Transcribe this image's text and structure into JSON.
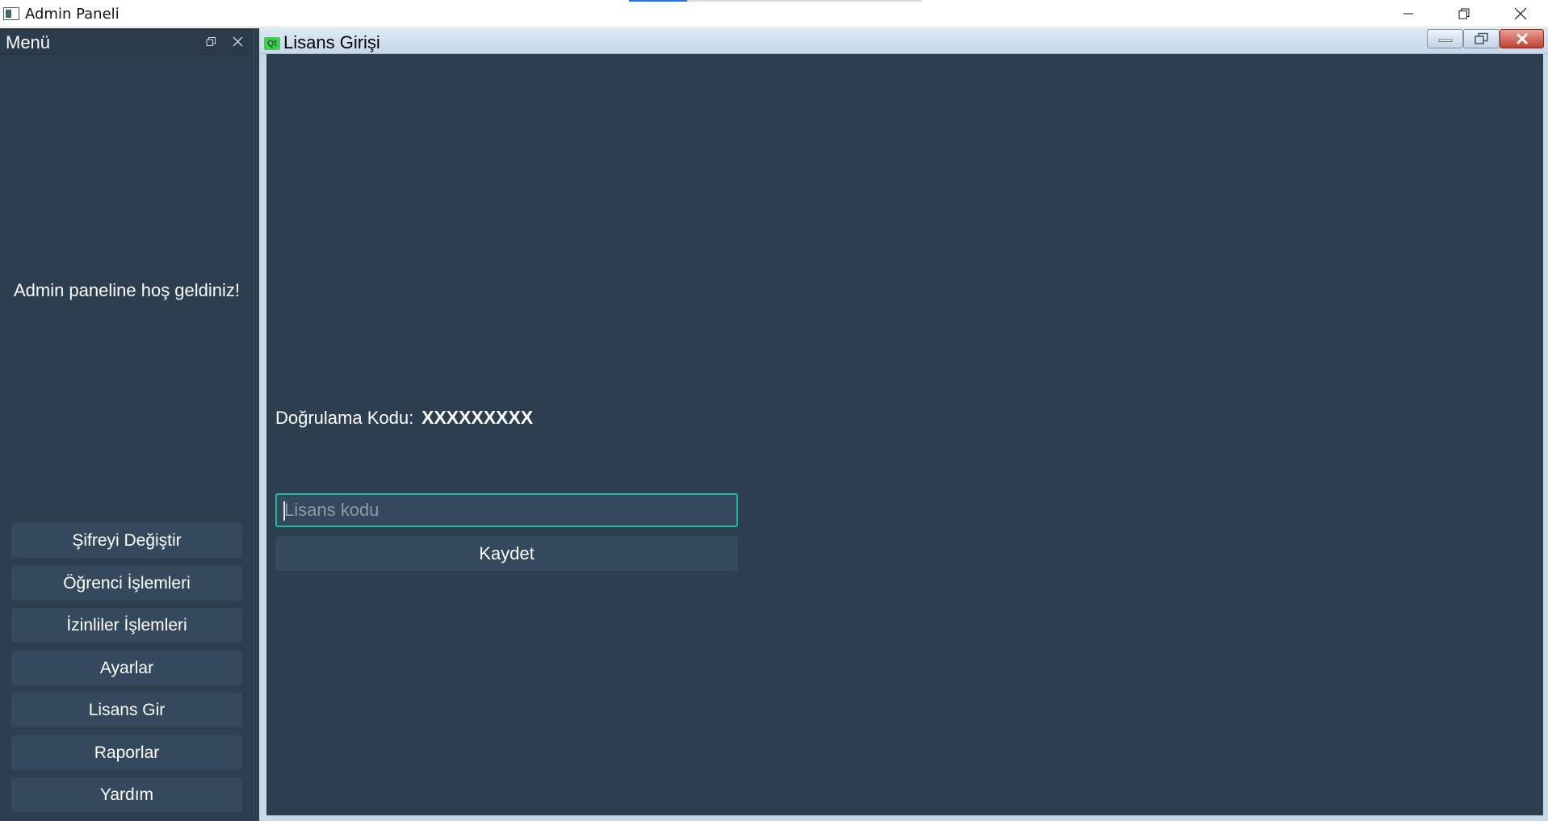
{
  "window": {
    "title": "Admin Paneli",
    "icons": {
      "app": "app-window-icon",
      "minimize": "minimize-icon",
      "restore": "restore-icon",
      "close": "close-icon"
    }
  },
  "dock": {
    "title": "Menü",
    "welcome_text": "Admin paneline hoş geldiniz!",
    "menu_items": [
      {
        "label": "Şifreyi Değiştir"
      },
      {
        "label": "Öğrenci İşlemleri"
      },
      {
        "label": "İzinliler İşlemleri"
      },
      {
        "label": "Ayarlar"
      },
      {
        "label": "Lisans Gir"
      },
      {
        "label": "Raporlar"
      },
      {
        "label": "Yardım"
      }
    ]
  },
  "subwindow": {
    "title": "Lisans Girişi",
    "icon_glyph": "Qt",
    "verification_label": "Doğrulama Kodu:",
    "verification_code": "XXXXXXXXX",
    "license_input": {
      "placeholder": "Lisans kodu",
      "value": ""
    },
    "save_label": "Kaydet"
  },
  "colors": {
    "background": "#2d3e50",
    "button": "#34495e",
    "input_focus_border": "#1abc9c",
    "text": "#ffffff"
  }
}
